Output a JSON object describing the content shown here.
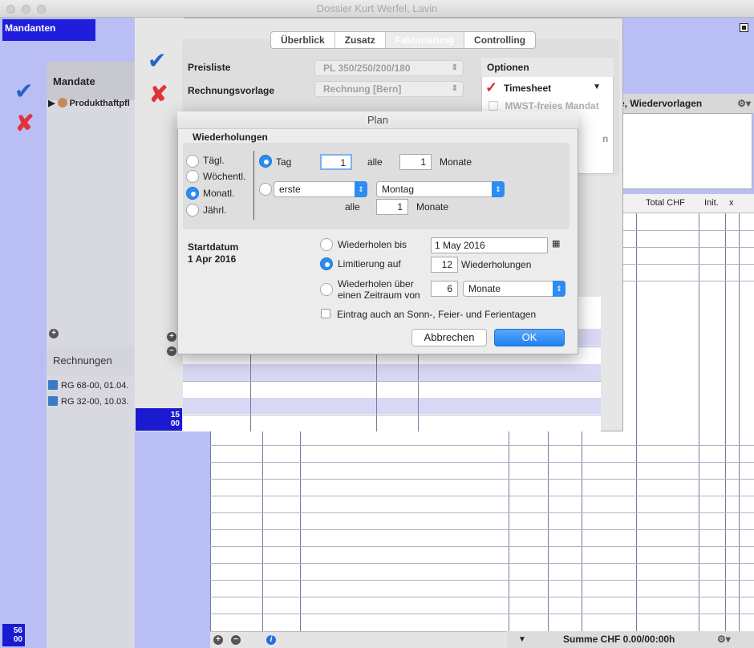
{
  "window": {
    "title": "Dossier Kurt Werfel, Lavin"
  },
  "main": {
    "mandanten_label": "Mandanten",
    "corner_badge_top": "56",
    "corner_badge_bottom": "00",
    "mandate_title": "Mandate",
    "mandate_item": "Produkthaftpfl",
    "rechnungen_title": "Rechnungen",
    "rechnungen_items": [
      "RG 68-00, 01.04.",
      "RG 32-00, 10.03."
    ],
    "right_panel_header": "e, Wiedervorlagen",
    "columns": [
      "Total CHF",
      "Init.",
      "x"
    ],
    "sum_label": "Summe CHF 0.00/00:00h"
  },
  "dossier": {
    "tabs": [
      "Überblick",
      "Zusatz",
      "Fakturierung",
      "Controlling"
    ],
    "selected_tab": "Fakturierung",
    "preisliste_label": "Preisliste",
    "preisliste_value": "PL 350/250/200/180",
    "rechnungsvorlage_label": "Rechnungsvorlage",
    "rechnungsvorlage_value": "Rechnung [Bern]",
    "optionen_title": "Optionen",
    "timesheet_label": "Timesheet",
    "mwst_label": "MWST-freies Mandat",
    "partial_text": "n",
    "badge_top": "15",
    "badge_bottom": "00"
  },
  "plan": {
    "title": "Plan",
    "section_title": "Wiederholungen",
    "frequencies": [
      "Tägl.",
      "Wöchentl.",
      "Monatl.",
      "Jährl."
    ],
    "selected_frequency": "Monatl.",
    "tag_label": "Tag",
    "tag_value": "1",
    "alle_label": "alle",
    "alle_value_1": "1",
    "monate_label": "Monate",
    "erste_value": "erste",
    "weekday_value": "Montag",
    "alle_value_2": "1",
    "startdatum_label": "Startdatum",
    "startdatum_value": "1 Apr 2016",
    "wiederholen_bis_label": "Wiederholen bis",
    "wiederholen_bis_value": "1 May 2016",
    "limitierung_label": "Limitierung auf",
    "limitierung_value": "12",
    "wiederholungen_label": "Wiederholungen",
    "zeitraum_label_1": "Wiederholen über",
    "zeitraum_label_2": "einen Zeitraum von",
    "zeitraum_value": "6",
    "zeitraum_unit": "Monate",
    "sonntag_label": "Eintrag auch an Sonn-, Feier- und Ferientagen",
    "cancel_label": "Abbrechen",
    "ok_label": "OK"
  },
  "colors": {
    "accent": "#2d8cf0",
    "badge": "#1a1ad0",
    "background": "#b9bef4"
  }
}
